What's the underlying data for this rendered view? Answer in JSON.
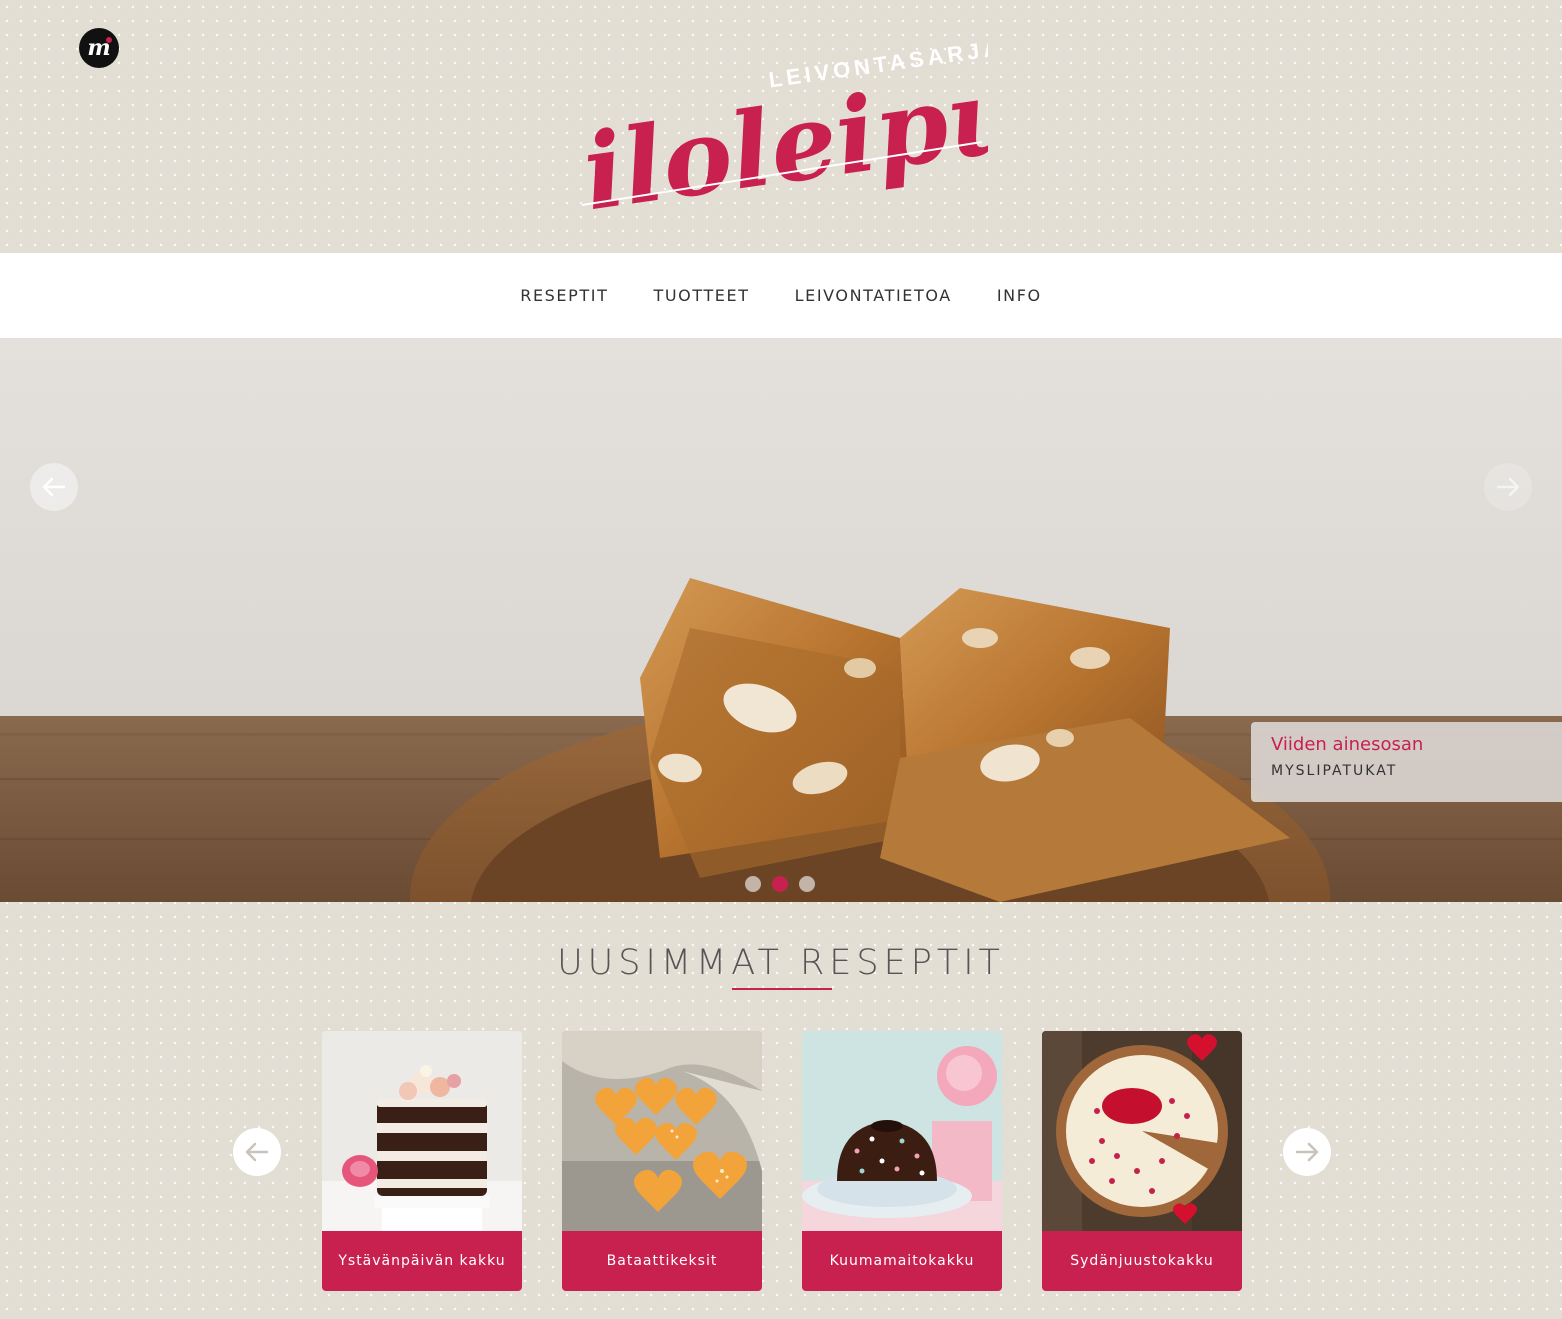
{
  "header": {
    "badge_letter": "m",
    "logo_small": "LEIVONTASARJA",
    "logo_main": "iloleipuri"
  },
  "nav": {
    "items": [
      "RESEPTIT",
      "TUOTTEET",
      "LEIVONTATIETOA",
      "INFO"
    ]
  },
  "hero": {
    "caption_title": "Viiden ainesosan",
    "caption_sub": "MYSLIPATUKAT",
    "slide_count": 3,
    "active_slide": 2
  },
  "section": {
    "title": "UUSIMMAT RESEPTIT"
  },
  "recipes": [
    {
      "label": "Ystävänpäivän kakku"
    },
    {
      "label": "Bataattikeksit"
    },
    {
      "label": "Kuumamaitokakku"
    },
    {
      "label": "Sydänjuustokakku"
    }
  ],
  "icons": {
    "prev": "arrow-left-icon",
    "next": "arrow-right-icon"
  },
  "colors": {
    "accent": "#c8204f",
    "background": "#e3ded4",
    "nav_text": "#333333"
  }
}
